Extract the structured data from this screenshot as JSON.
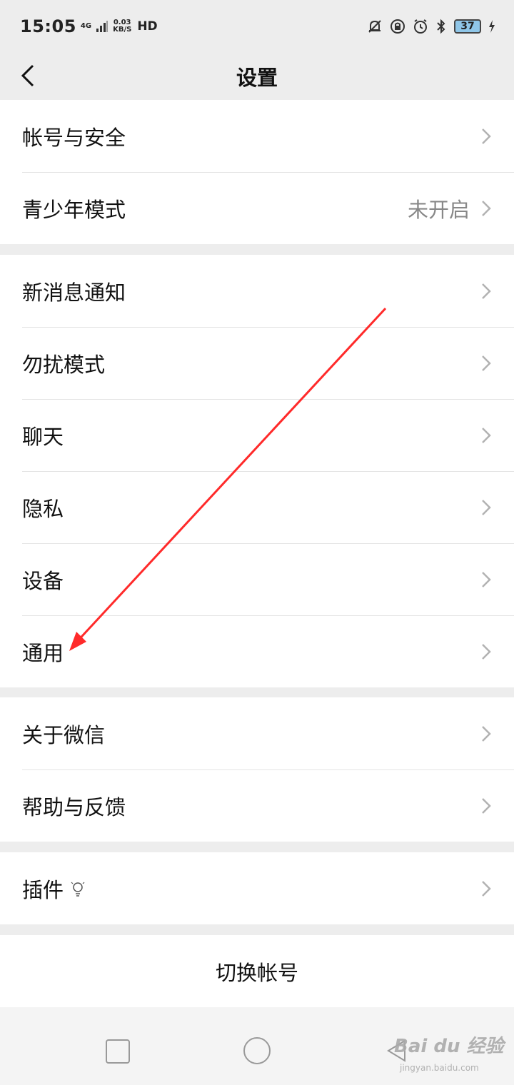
{
  "status_bar": {
    "time": "15:05",
    "network": "4G",
    "speed_value": "0.03",
    "speed_unit": "KB/S",
    "hd": "HD",
    "battery": "37",
    "icons": [
      "mute-icon",
      "rotation-lock-icon",
      "alarm-icon",
      "bluetooth-icon",
      "charging-icon"
    ]
  },
  "nav": {
    "title": "设置"
  },
  "groups": [
    {
      "items": [
        {
          "label": "帐号与安全",
          "value": ""
        },
        {
          "label": "青少年模式",
          "value": "未开启"
        }
      ]
    },
    {
      "items": [
        {
          "label": "新消息通知",
          "value": ""
        },
        {
          "label": "勿扰模式",
          "value": ""
        },
        {
          "label": "聊天",
          "value": ""
        },
        {
          "label": "隐私",
          "value": ""
        },
        {
          "label": "设备",
          "value": ""
        },
        {
          "label": "通用",
          "value": ""
        }
      ]
    },
    {
      "items": [
        {
          "label": "关于微信",
          "value": ""
        },
        {
          "label": "帮助与反馈",
          "value": ""
        }
      ]
    },
    {
      "items": [
        {
          "label": "插件",
          "value": "",
          "icon": "lightbulb-icon"
        }
      ]
    }
  ],
  "switch_account": "切换帐号",
  "watermark": {
    "text": "Bai du 经验",
    "sub": "jingyan.baidu.com"
  },
  "annotation": {
    "color": "#ff2a2a"
  }
}
